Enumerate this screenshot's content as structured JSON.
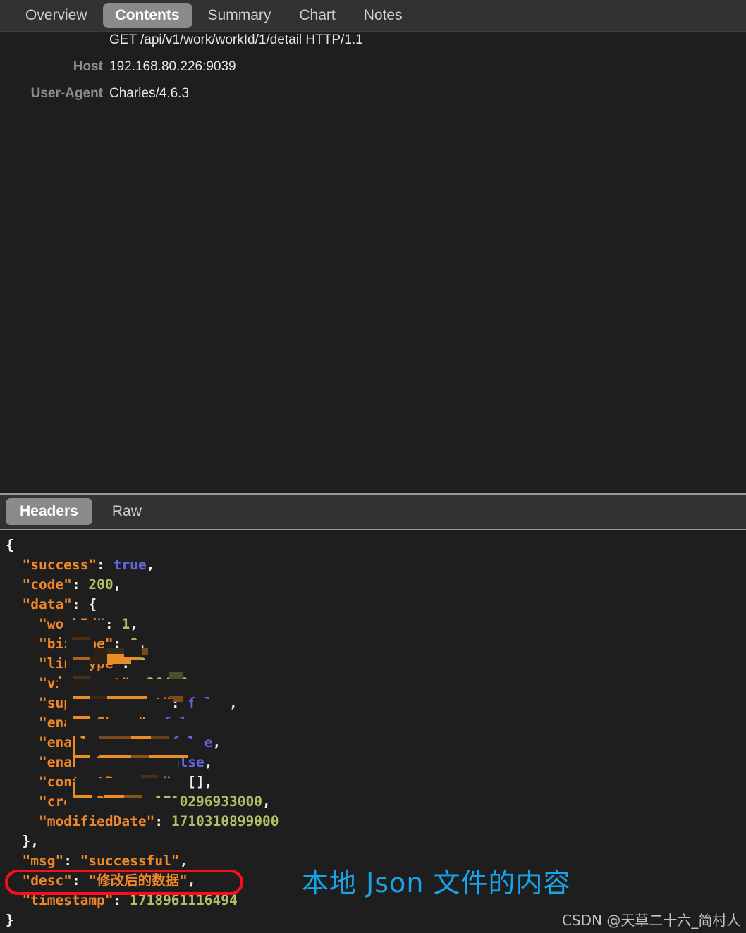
{
  "top_tabs": [
    {
      "label": "Overview",
      "active": false
    },
    {
      "label": "Contents",
      "active": true
    },
    {
      "label": "Summary",
      "active": false
    },
    {
      "label": "Chart",
      "active": false
    },
    {
      "label": "Notes",
      "active": false
    }
  ],
  "request_headers": [
    {
      "label": "",
      "value": "GET /api/v1/work/workId/1/detail HTTP/1.1"
    },
    {
      "label": "Host",
      "value": "192.168.80.226:9039"
    },
    {
      "label": "User-Agent",
      "value": "Charles/4.6.3"
    }
  ],
  "bottom_tabs": [
    {
      "label": "Headers",
      "active": true
    },
    {
      "label": "Raw",
      "active": false
    }
  ],
  "json_body": {
    "lines": [
      "{",
      "  \"success\": true,",
      "  \"code\": 200,",
      "  \"data\": {",
      "    \"workId\": 1,",
      "    \"bizType\": 0,",
      "    \"linkType\": 0,",
      "    \"viewCount\": 36476,",
      "    \"supportComment\": false,",
      "    \"enableShare\": false,",
      "    \"enableAnswer\": false,",
      "    \"enableMusic\": false,",
      "    \"contentRecords\": [],",
      "    \"createDate\": 1710296933000,",
      "    \"modifiedDate\": 1710310899000",
      "  },",
      "  \"msg\": \"successful\",",
      "  \"desc\": \"修改后的数据\",",
      "  \"timestamp\": 1718961116494",
      "}"
    ],
    "values": {
      "success": "true",
      "code": "200",
      "workId": "1",
      "bizType": "0",
      "linkType": "0",
      "viewCount": "36476",
      "supportComment": "false",
      "enableShare": "false",
      "enableAnswer": "false",
      "enableMusic": "false",
      "contentRecords": "[]",
      "createDate": "1710296933000",
      "modifiedDate": "1710310899000",
      "msg": "successful",
      "desc": "修改后的数据",
      "timestamp": "1718961116494"
    },
    "visible_tokens": {
      "l1_open_brace": "{",
      "l2": "\"success\": true,",
      "l3": "\"code\": 200,",
      "l4": "\"data\": {",
      "l5_partial": "\"w   kId\": 1,",
      "l6_partial": "\"b    ype\": 0,",
      "l7_partial": "\"l   Ty  \": 0,",
      "l8_partial": "\"          \": 36476,",
      "l9_partial": "\"            it\": false,",
      "l10_partial": "\"e          , false,",
      "l11_partial": "\"en       wer\": false,",
      "l12_partial": "\"en       c\": false,",
      "l13_partial": "\"co      ds\": [],",
      "l14_partial": "\"c        \": 1710296933000,",
      "l15_partial": "\"mo    edate\": 1710310899000",
      "l16_close": "},",
      "l17": "\"msg\": \"successful\",",
      "l18": "\"desc\": \"修改后的数据\",",
      "l19": "\"timestamp\": 1718961116494",
      "l20_close_brace": "}"
    }
  },
  "annotations": {
    "note": "本地 Json 文件的内容",
    "note_color": "#19a3e8",
    "highlight_box_color": "#fc0d1b",
    "highlight_target_key": "desc"
  },
  "watermark": "CSDN @天草二十六_简村人",
  "colors": {
    "background": "#1e1e1e",
    "tabbar_background": "#313234",
    "active_tab_background": "#8a8a8a",
    "json_key": "#f0872a",
    "json_number": "#b5bd68",
    "json_boolean": "#6565e0",
    "json_punctuation": "#f2f2f2",
    "header_label": "#8d8d8d",
    "separator": "#9a9a9a"
  }
}
